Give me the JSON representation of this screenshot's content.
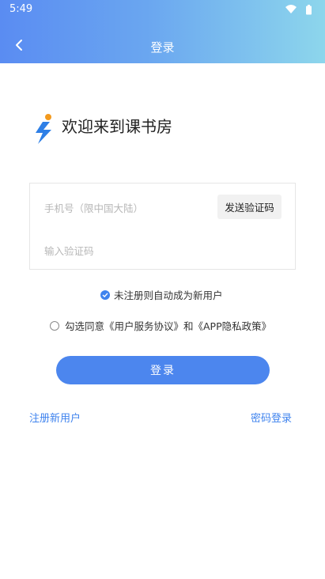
{
  "status_bar": {
    "time": "5:49",
    "icons": [
      "wifi-icon",
      "battery-icon"
    ]
  },
  "header": {
    "title": "登录",
    "back_icon": "back-arrow-icon"
  },
  "brand": {
    "welcome": "欢迎来到课书房",
    "logo": "app-logo-icon"
  },
  "form": {
    "phone_placeholder": "手机号（限中国大陆）",
    "phone_value": "",
    "send_code_label": "发送验证码",
    "code_placeholder": "输入验证码",
    "code_value": ""
  },
  "options": {
    "auto_register": {
      "label": "未注册则自动成为新用户",
      "checked": true
    },
    "agreement": {
      "label": "勾选同意《用户服务协议》和《APP隐私政策》",
      "checked": false
    }
  },
  "actions": {
    "login_label": "登录",
    "register_label": "注册新用户",
    "password_login_label": "密码登录"
  },
  "colors": {
    "accent": "#4c86ee",
    "header_gradient_start": "#5a8cf2",
    "header_gradient_end": "#8dd6ec"
  }
}
